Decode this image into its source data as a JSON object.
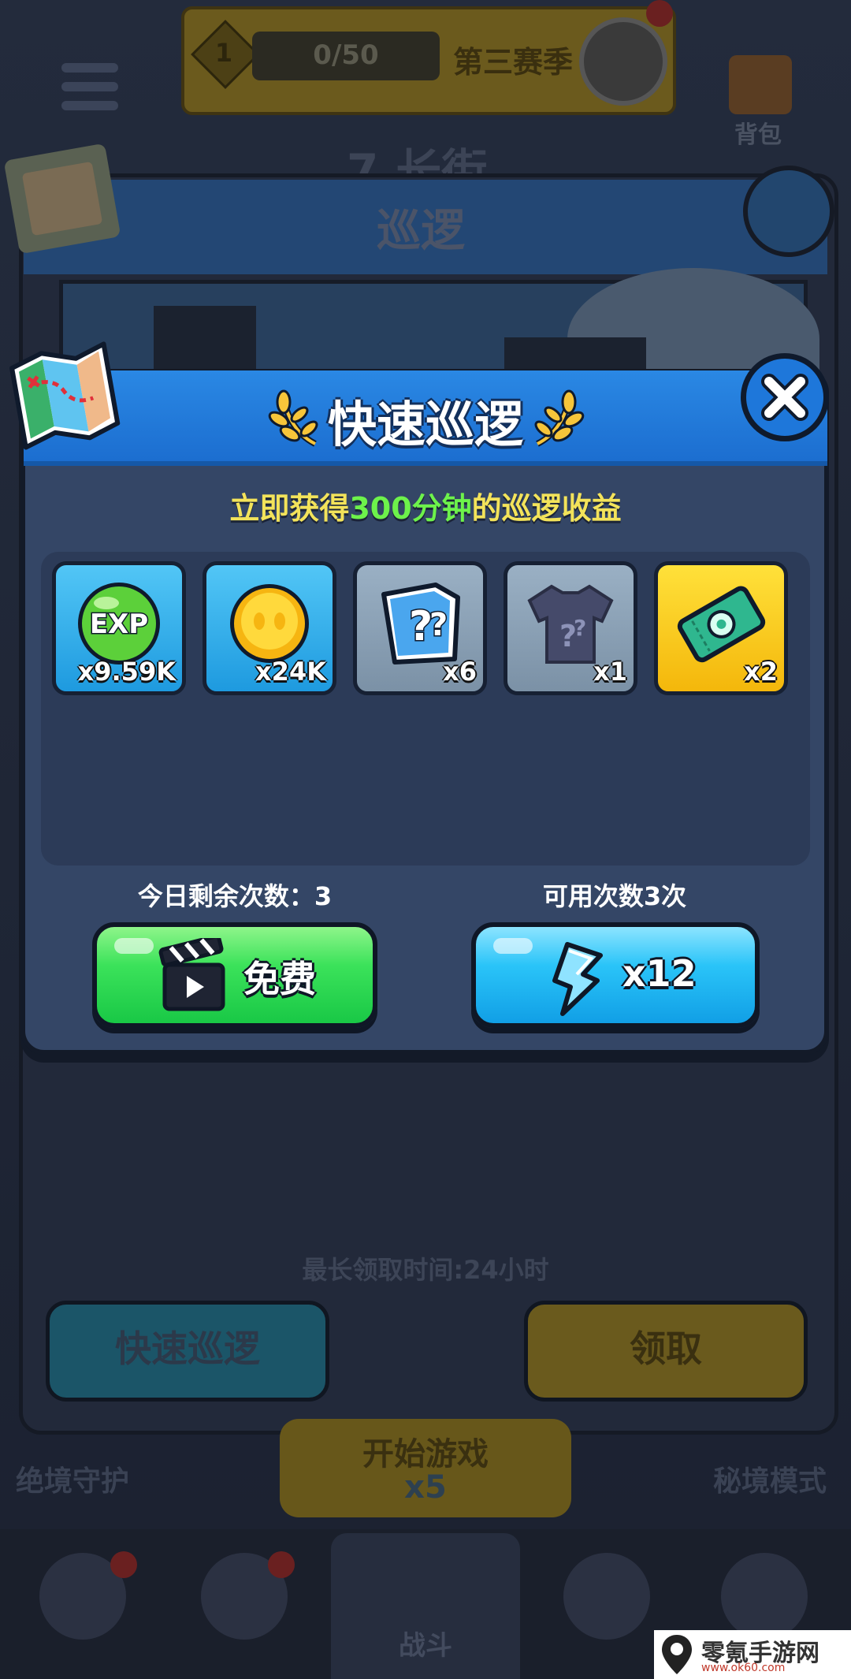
{
  "background": {
    "level": "1",
    "season_progress": "0/50",
    "season_label": "第三赛季",
    "bag_label": "背包",
    "street_title": "7.长街",
    "panel_title": "巡逻",
    "max_time_text": "最长领取时间:24小时",
    "quick_patrol_button": "快速巡逻",
    "claim_button": "领取",
    "mode_left": "绝境守护",
    "mode_right": "秘境模式",
    "start_game": "开始游戏",
    "start_cost": "x5",
    "nav_battle": "战斗"
  },
  "dialog": {
    "title": "快速巡逻",
    "subtitle_prefix": "立即获得",
    "subtitle_highlight": "300分钟",
    "subtitle_suffix": "的巡逻收益",
    "rewards": [
      {
        "icon": "exp-orb-icon",
        "qty": "x9.59K",
        "style": "blue"
      },
      {
        "icon": "gold-coin-icon",
        "qty": "x24K",
        "style": "blue"
      },
      {
        "icon": "mystery-map-icon",
        "qty": "x6",
        "style": "grey"
      },
      {
        "icon": "mystery-armor-icon",
        "qty": "x1",
        "style": "grey"
      },
      {
        "icon": "ticket-icon",
        "qty": "x2",
        "style": "gold"
      }
    ],
    "exp_label": "EXP",
    "remaining_today": "今日剩余次数：3",
    "available_count": "可用次数3次",
    "free_button": "免费",
    "energy_button": "x12"
  },
  "watermark": {
    "name": "零氪手游网",
    "url": "www.ok60.com"
  },
  "colors": {
    "header_blue": "#1e77da",
    "free_green": "#19c846",
    "energy_cyan": "#2ac4f8",
    "highlight_green": "#6df24b",
    "subtitle_yellow": "#f3e35a"
  }
}
